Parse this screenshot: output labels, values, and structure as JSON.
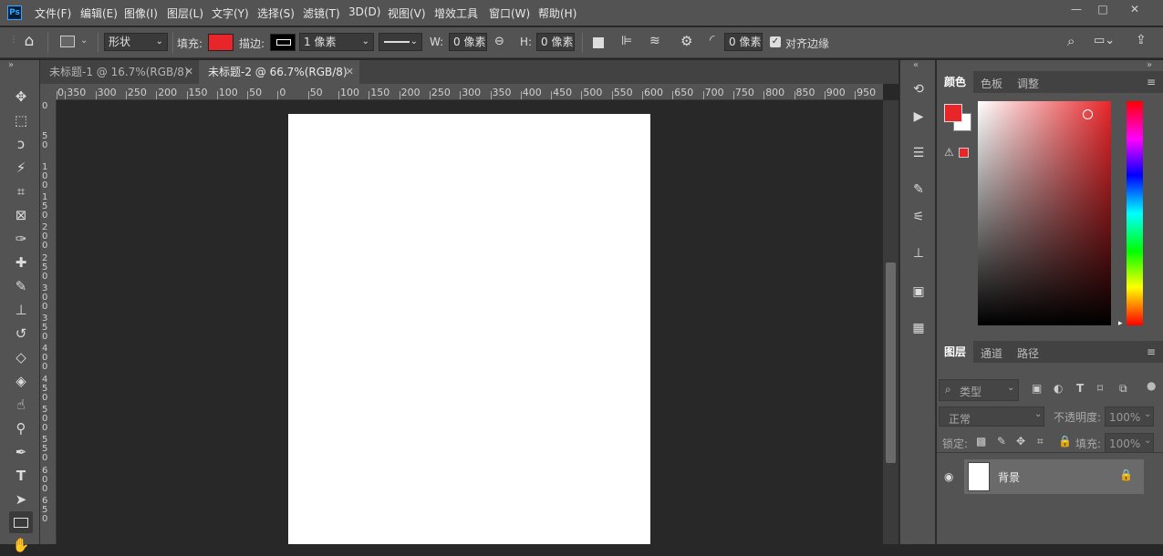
{
  "app": {
    "logo": "Ps"
  },
  "menu": [
    "文件(F)",
    "编辑(E)",
    "图像(I)",
    "图层(L)",
    "文字(Y)",
    "选择(S)",
    "滤镜(T)",
    "3D(D)",
    "视图(V)",
    "增效工具",
    "窗口(W)",
    "帮助(H)"
  ],
  "window_controls": {
    "minimize": "—",
    "maximize": "□",
    "close": "✕"
  },
  "options": {
    "mode": "形状",
    "fill_label": "填充:",
    "fill_color": "#e8262a",
    "stroke_label": "描边:",
    "stroke_width": "1 像素",
    "w_label": "W:",
    "w_value": "0 像素",
    "h_label": "H:",
    "h_value": "0 像素",
    "radius_value": "0 像素",
    "align_edges": "对齐边缘"
  },
  "tabs": [
    {
      "label": "未标题-1 @ 16.7%(RGB/8)",
      "active": false
    },
    {
      "label": "未标题-2 @ 66.7%(RGB/8)",
      "active": true
    }
  ],
  "ruler_top": [
    "0",
    "350",
    "300",
    "250",
    "200",
    "150",
    "100",
    "50",
    "0",
    "50",
    "100",
    "150",
    "200",
    "250",
    "300",
    "350",
    "400",
    "450",
    "500",
    "550",
    "600",
    "650",
    "700",
    "750",
    "800",
    "850",
    "900",
    "950"
  ],
  "ruler_left": [
    "0",
    "5 0",
    "1 0 0",
    "1 5 0",
    "2 0 0",
    "2 5 0",
    "3 0 0",
    "3 5 0",
    "4 0 0",
    "4 5 0",
    "5 0 0",
    "5 5 0",
    "6 0 0",
    "6 5 0"
  ],
  "color_panel": {
    "tabs": [
      "颜色",
      "色板",
      "调整"
    ],
    "foreground": "#e8262a",
    "background": "#ffffff",
    "warning_color": "#e8262a"
  },
  "layers_panel": {
    "tabs": [
      "图层",
      "通道",
      "路径"
    ],
    "filter_placeholder": "类型",
    "blend_mode": "正常",
    "opacity_label": "不透明度:",
    "opacity_value": "100%",
    "lock_label": "锁定:",
    "fill_label": "填充:",
    "fill_value": "100%",
    "layers": [
      {
        "name": "背景",
        "visible": true,
        "locked": true
      }
    ]
  }
}
